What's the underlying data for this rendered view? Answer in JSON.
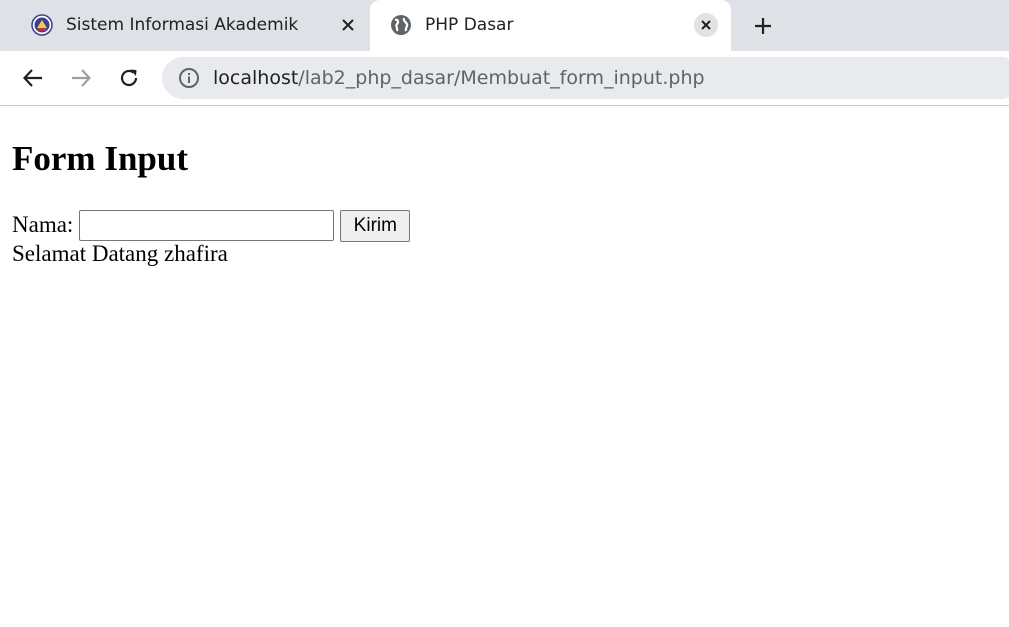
{
  "tabs": [
    {
      "title": "Sistem Informasi Akademik",
      "favicon": "university-logo-icon",
      "active": false
    },
    {
      "title": "PHP Dasar",
      "favicon": "globe-icon",
      "active": true
    }
  ],
  "toolbar": {
    "back_icon": "back-arrow-icon",
    "forward_icon": "forward-arrow-icon",
    "reload_icon": "reload-icon",
    "url_host": "localhost",
    "url_path": "/lab2_php_dasar/Membuat_form_input.php"
  },
  "page": {
    "heading": "Form Input",
    "form": {
      "label": "Nama:",
      "input_value": "",
      "submit_label": "Kirim"
    },
    "greeting": "Selamat Datang zhafira"
  },
  "colors": {
    "tabstrip_bg": "#dee1e6",
    "omnibox_bg": "#e8eaed",
    "url_path_color": "#5f6368"
  }
}
